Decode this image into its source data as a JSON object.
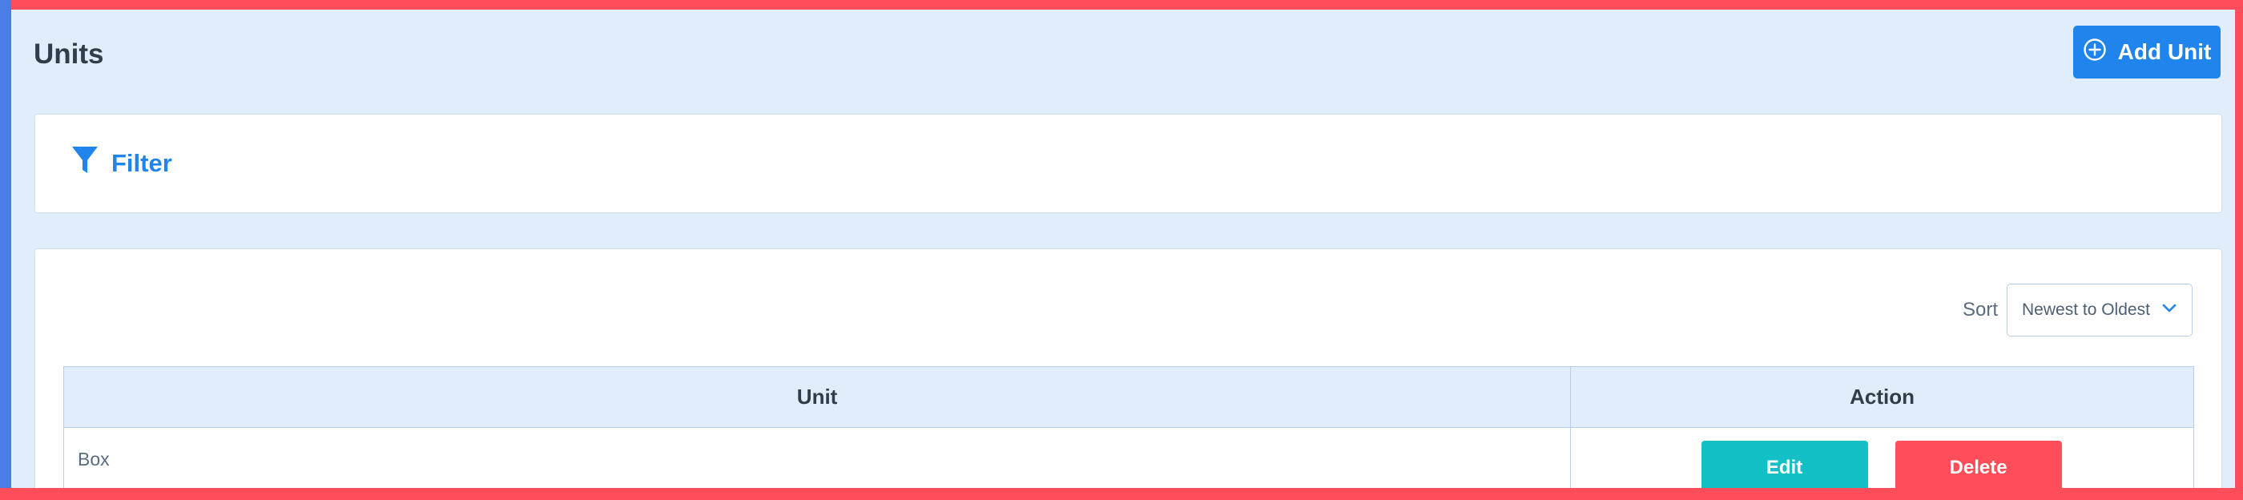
{
  "header": {
    "title": "Units",
    "add_button_label": "Add Unit",
    "add_button_icon": "plus-circle-icon"
  },
  "filter": {
    "label": "Filter",
    "icon": "funnel-icon"
  },
  "sort": {
    "label": "Sort",
    "selected": "Newest to Oldest",
    "icon": "chevron-down-icon"
  },
  "table": {
    "columns": [
      "Unit",
      "Action"
    ],
    "rows": [
      {
        "unit": "Box",
        "edit_label": "Edit",
        "delete_label": "Delete"
      }
    ]
  },
  "colors": {
    "primary": "#1f84ec",
    "edit": "#12c0c6",
    "delete": "#ff4d5a",
    "page_bg": "#e2edfb",
    "frame": "#ff4d5a"
  }
}
